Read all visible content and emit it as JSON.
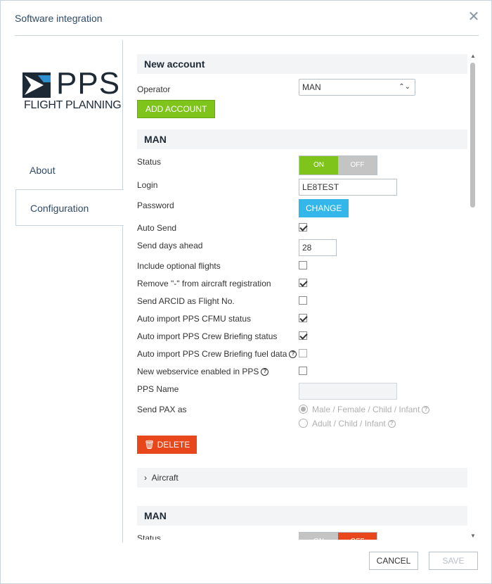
{
  "dialog": {
    "title": "Software integration"
  },
  "logo": {
    "name": "PPS",
    "subtitle": "FLIGHT PLANNING"
  },
  "nav": {
    "about": "About",
    "configuration": "Configuration"
  },
  "new_account": {
    "heading": "New account",
    "operator_label": "Operator",
    "operator_value": "MAN",
    "add_button": "ADD ACCOUNT"
  },
  "account": {
    "heading": "MAN",
    "status_label": "Status",
    "status_on": "ON",
    "status_off": "OFF",
    "login_label": "Login",
    "login_value": "LE8TEST",
    "password_label": "Password",
    "change_button": "CHANGE",
    "auto_send_label": "Auto Send",
    "send_days_label": "Send days ahead",
    "send_days_value": "28",
    "include_optional_label": "Include optional flights",
    "remove_dash_label": "Remove \"-\" from aircraft registration",
    "send_arcid_label": "Send ARCID as Flight No.",
    "auto_cfmu_label": "Auto import PPS CFMU status",
    "auto_crew_label": "Auto import PPS Crew Briefing status",
    "auto_fuel_label": "Auto import PPS Crew Briefing fuel data",
    "new_ws_label": "New webservice enabled in PPS",
    "pps_name_label": "PPS Name",
    "send_pax_label": "Send PAX as",
    "pax_option_1": "Male / Female / Child / Infant",
    "pax_option_2": "Adult / Child / Infant",
    "delete_button": "DELETE",
    "aircraft_label": "Aircraft"
  },
  "account2": {
    "heading": "MAN",
    "status_label": "Status",
    "status_on": "ON",
    "status_off": "OFF"
  },
  "footer": {
    "cancel": "CANCEL",
    "save": "SAVE"
  }
}
